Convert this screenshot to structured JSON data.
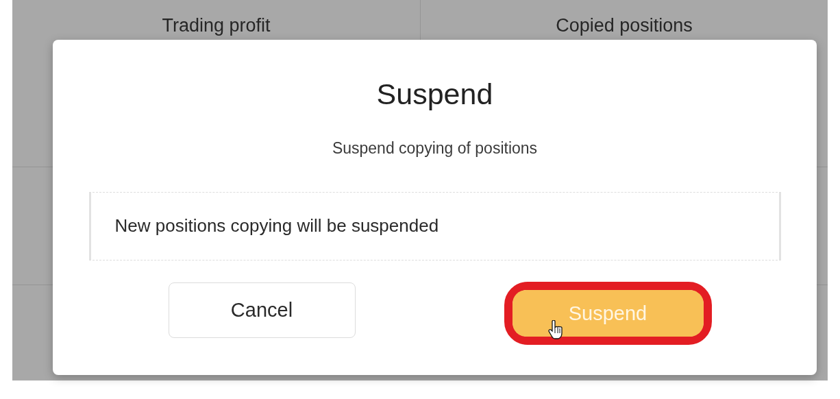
{
  "background_table": {
    "columns": [
      "Trading profit",
      "Copied positions"
    ]
  },
  "dialog": {
    "title": "Suspend",
    "subtitle": "Suspend copying of positions",
    "note": "New positions copying will be suspended",
    "buttons": [
      {
        "label": "Cancel",
        "kind": "secondary",
        "highlighted": false,
        "cursor": false
      },
      {
        "label": "Suspend",
        "kind": "primary",
        "highlighted": true,
        "cursor": true
      }
    ]
  }
}
